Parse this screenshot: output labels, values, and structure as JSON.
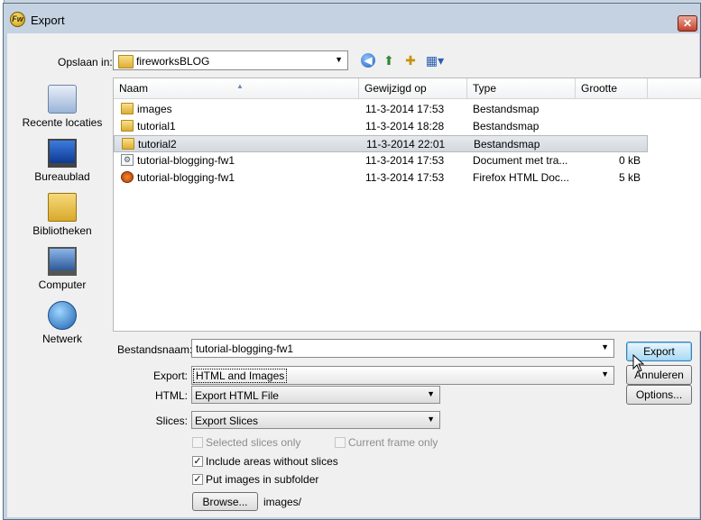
{
  "window": {
    "title": "Export",
    "app_icon_letter": "Fw",
    "close_glyph": "✕"
  },
  "toolbar": {
    "lookin_label": "Opslaan in:",
    "lookin_value": "fireworksBLOG",
    "back_glyph": "◀",
    "up_glyph": "⬆",
    "newfolder_glyph": "✚",
    "view_glyph": "▦▾"
  },
  "places": [
    {
      "label": "Recente locaties",
      "icon": "recent-places-icon"
    },
    {
      "label": "Bureaublad",
      "icon": "desktop-icon"
    },
    {
      "label": "Bibliotheken",
      "icon": "libraries-icon"
    },
    {
      "label": "Computer",
      "icon": "computer-icon"
    },
    {
      "label": "Netwerk",
      "icon": "network-icon"
    }
  ],
  "filelist": {
    "columns": [
      "Naam",
      "Gewijzigd op",
      "Type",
      "Grootte"
    ],
    "rows": [
      {
        "name": "images",
        "modified": "11-3-2014 17:53",
        "type": "Bestandsmap",
        "size": "",
        "icon": "folder-icon"
      },
      {
        "name": "tutorial1",
        "modified": "11-3-2014 18:28",
        "type": "Bestandsmap",
        "size": "",
        "icon": "folder-icon"
      },
      {
        "name": "tutorial2",
        "modified": "11-3-2014 22:01",
        "type": "Bestandsmap",
        "size": "",
        "icon": "folder-icon",
        "selected": true
      },
      {
        "name": "tutorial-blogging-fw1",
        "modified": "11-3-2014 17:53",
        "type": "Document met tra...",
        "size": "0 kB",
        "icon": "document-icon"
      },
      {
        "name": "tutorial-blogging-fw1",
        "modified": "11-3-2014 17:53",
        "type": "Firefox HTML Doc...",
        "size": "5 kB",
        "icon": "firefox-html-icon"
      }
    ]
  },
  "form": {
    "filename_label": "Bestandsnaam:",
    "filename_value": "tutorial-blogging-fw1",
    "export_label": "Export:",
    "export_value": "HTML and Images",
    "html_label": "HTML:",
    "html_value": "Export HTML File",
    "slices_label": "Slices:",
    "slices_value": "Export Slices",
    "selected_slices_only": "Selected slices only",
    "current_frame_only": "Current frame only",
    "include_areas": "Include areas without slices",
    "put_images": "Put images in subfolder",
    "browse_label": "Browse...",
    "subfolder_path": "images/",
    "check_glyph": "✓"
  },
  "buttons": {
    "export": "Export",
    "cancel": "Annuleren",
    "options": "Options..."
  }
}
